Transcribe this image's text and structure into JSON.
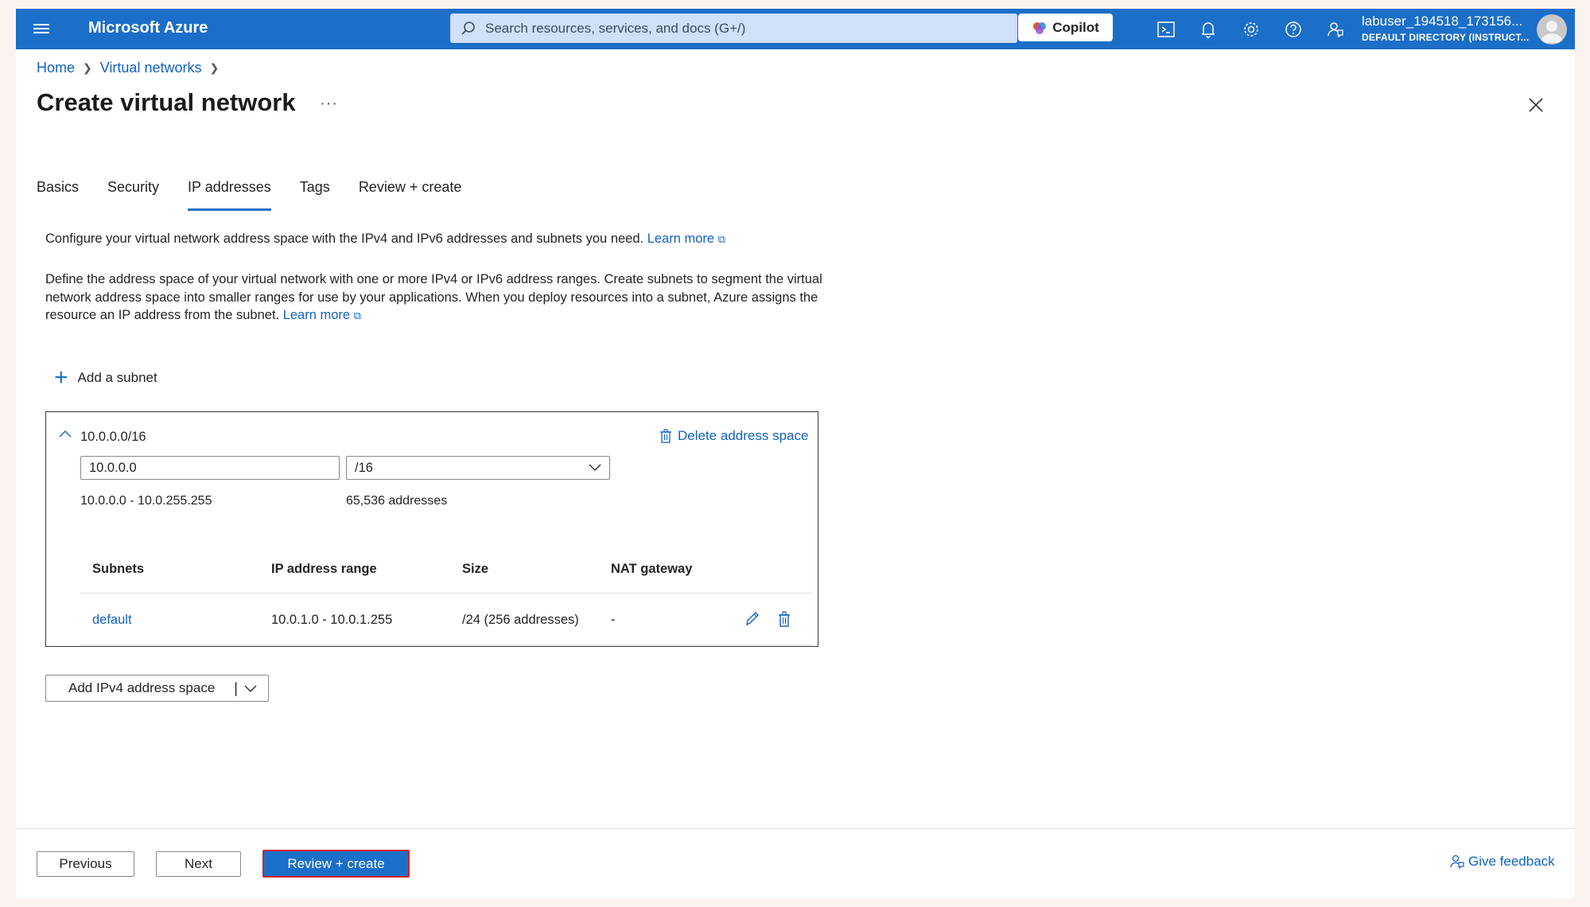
{
  "topbar": {
    "brand": "Microsoft Azure",
    "search_placeholder": "Search resources, services, and docs (G+/)",
    "copilot_label": "Copilot",
    "user_name": "labuser_194518_173156...",
    "directory": "DEFAULT DIRECTORY (INSTRUCT...",
    "brand_color": "#1b6fc8"
  },
  "breadcrumb": {
    "home": "Home",
    "parent": "Virtual networks"
  },
  "page": {
    "title": "Create virtual network",
    "more": "···"
  },
  "tabs": [
    {
      "label": "Basics",
      "active": false
    },
    {
      "label": "Security",
      "active": false
    },
    {
      "label": "IP addresses",
      "active": true
    },
    {
      "label": "Tags",
      "active": false
    },
    {
      "label": "Review + create",
      "active": false
    }
  ],
  "intro": {
    "line1": "Configure your virtual network address space with the IPv4 and IPv6 addresses and subnets you need.",
    "learn_more": "Learn more",
    "paragraph": "Define the address space of your virtual network with one or more IPv4 or IPv6 address ranges. Create subnets to segment the virtual network address space into smaller ranges for use by your applications. When you deploy resources into a subnet, Azure assigns the resource an IP address from the subnet."
  },
  "add_subnet_label": "Add a subnet",
  "address_space": {
    "title": "10.0.0.0/16",
    "delete_label": "Delete address space",
    "ip_value": "10.0.0.0",
    "mask_value": "/16",
    "range_text": "10.0.0.0 - 10.0.255.255",
    "count_text": "65,536 addresses",
    "columns": [
      "Subnets",
      "IP address range",
      "Size",
      "NAT gateway"
    ],
    "rows": [
      {
        "name": "default",
        "range": "10.0.1.0 - 10.0.1.255",
        "size": "/24 (256 addresses)",
        "nat": "-"
      }
    ]
  },
  "add_space": {
    "label": "Add IPv4 address space",
    "pipe": "|"
  },
  "footer": {
    "previous": "Previous",
    "next": "Next",
    "review_create": "Review + create",
    "feedback": "Give feedback"
  }
}
